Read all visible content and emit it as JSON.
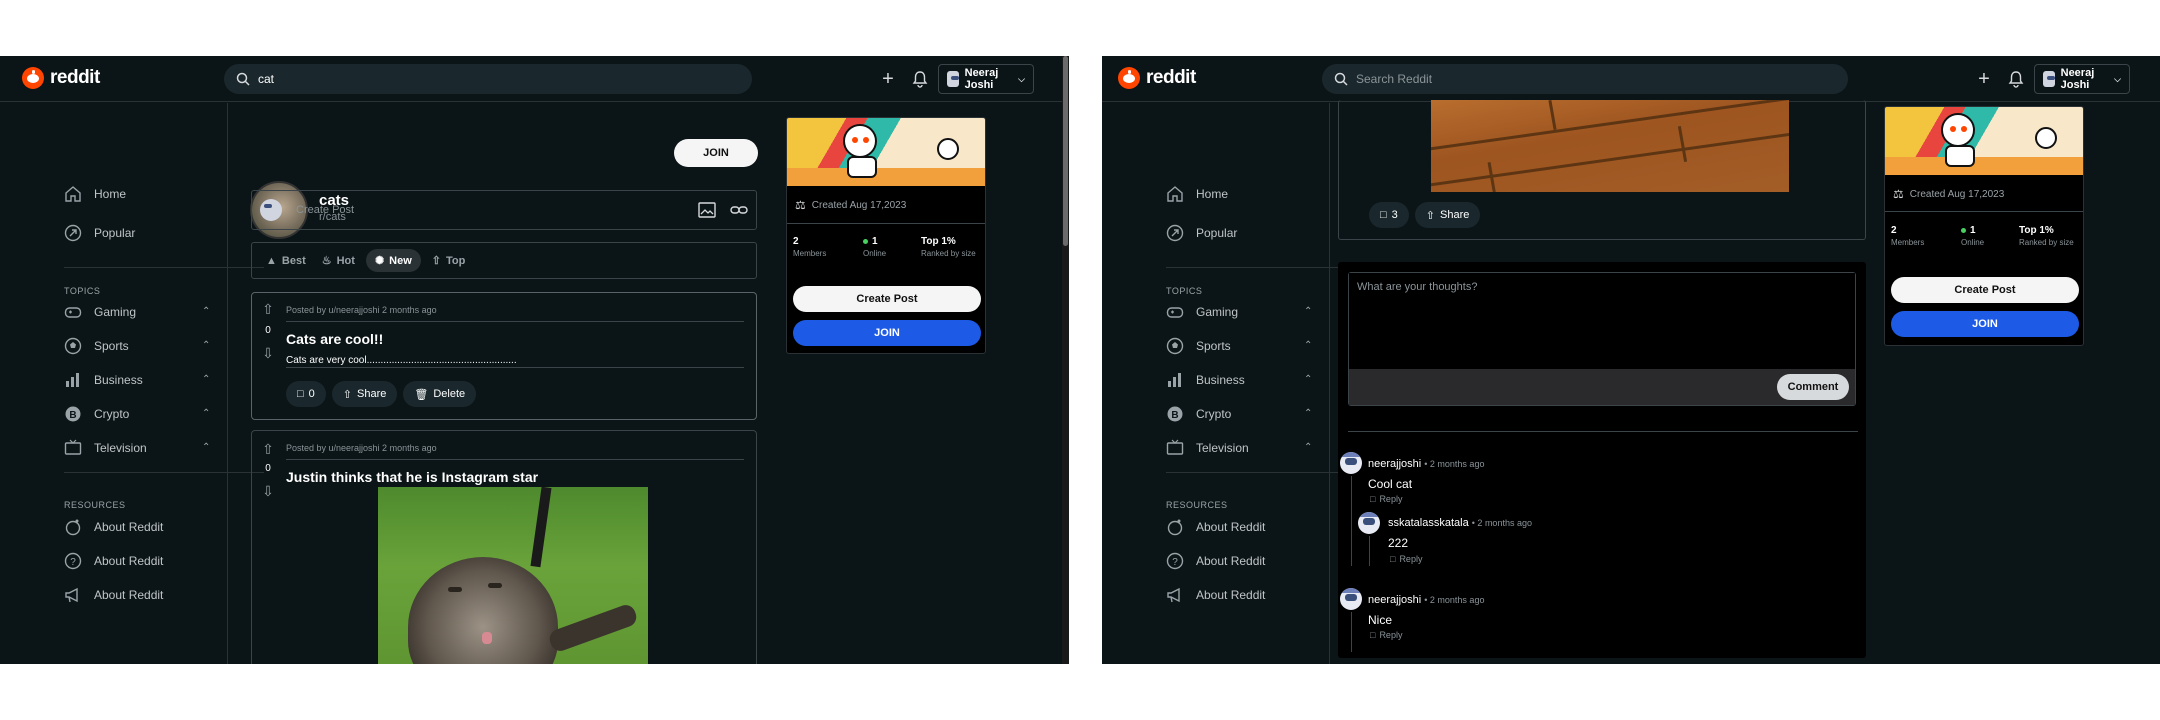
{
  "brand": "reddit",
  "left": {
    "search_value": "cat",
    "user_name": "Neeraj Joshi",
    "nav": {
      "home": "Home",
      "popular": "Popular",
      "topics_title": "TOPICS",
      "topics": [
        "Gaming",
        "Sports",
        "Business",
        "Crypto",
        "Television"
      ],
      "resources_title": "RESOURCES",
      "resources": [
        "About Reddit",
        "About Reddit",
        "About Reddit"
      ]
    },
    "community": {
      "name": "cats",
      "sub": "r/cats",
      "join": "JOIN"
    },
    "create_post_placeholder": "Create Post",
    "sort": [
      "Best",
      "Hot",
      "New",
      "Top"
    ],
    "sort_active": "New",
    "posts": [
      {
        "meta": "Posted by u/neerajjoshi 2 months ago",
        "votes": "0",
        "title": "Cats are cool!!",
        "body": "Cats are very cool......................................................",
        "comments": "0",
        "share": "Share",
        "delete": "Delete"
      },
      {
        "meta": "Posted by u/neerajjoshi 2 months ago",
        "votes": "0",
        "title": "Justin thinks that he is Instagram star"
      }
    ],
    "widget": {
      "created": "Created Aug 17,2023",
      "members_value": "2",
      "members_label": "Members",
      "online_value": "1",
      "online_label": "Online",
      "rank_value": "Top 1%",
      "rank_label": "Ranked by size",
      "create_post": "Create Post",
      "join": "JOIN"
    }
  },
  "right": {
    "search_placeholder": "Search Reddit",
    "user_name": "Neeraj Joshi",
    "post_actions": {
      "comments": "3",
      "share": "Share"
    },
    "comment_placeholder": "What are your thoughts?",
    "comment_button": "Comment",
    "comments": [
      {
        "user": "neerajjoshi",
        "time": "• 2 months ago",
        "text": "Cool cat",
        "reply": "Reply"
      },
      {
        "user": "sskatalasskatala",
        "time": "• 2 months ago",
        "text": "222",
        "reply": "Reply"
      },
      {
        "user": "neerajjoshi",
        "time": "• 2 months ago",
        "text": "Nice",
        "reply": "Reply"
      }
    ],
    "widget": {
      "created": "Created Aug 17,2023",
      "members_value": "2",
      "members_label": "Members",
      "online_value": "1",
      "online_label": "Online",
      "rank_value": "Top 1%",
      "rank_label": "Ranked by size",
      "create_post": "Create Post",
      "join": "JOIN"
    }
  },
  "colors": {
    "background": "#0b1416",
    "accent": "#ff4500",
    "join_blue": "#1d5be6",
    "online_green": "#46d160"
  },
  "icons": [
    "search-icon",
    "plus-icon",
    "bell-icon",
    "chevron-down-icon",
    "home-icon",
    "popular-icon",
    "gamepad-icon",
    "sports-icon",
    "business-icon",
    "crypto-icon",
    "television-icon",
    "about-icon",
    "help-icon",
    "megaphone-icon",
    "image-icon",
    "link-icon",
    "upvote-icon",
    "downvote-icon",
    "comment-icon",
    "share-icon",
    "trash-icon",
    "cake-icon"
  ]
}
